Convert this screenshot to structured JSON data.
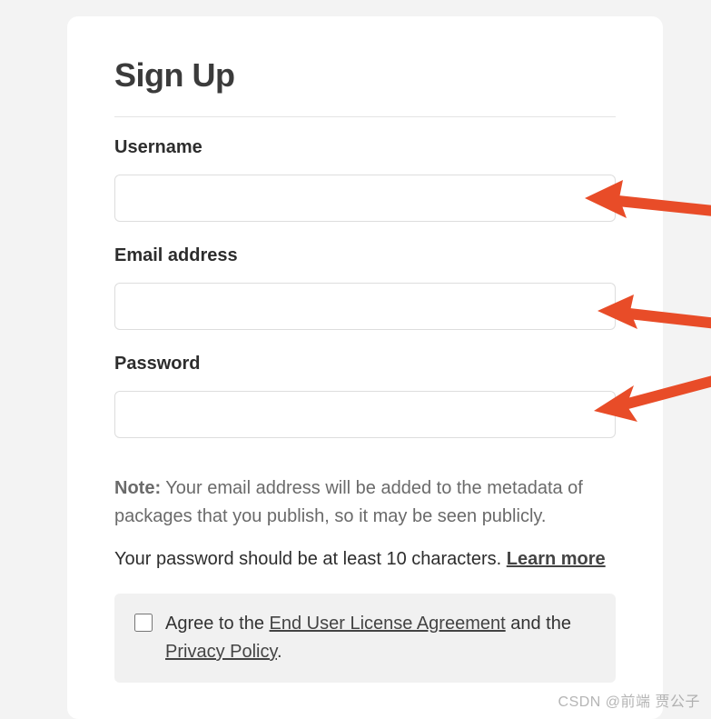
{
  "form": {
    "title": "Sign Up",
    "username_label": "Username",
    "username_value": "",
    "email_label": "Email address",
    "email_value": "",
    "password_label": "Password",
    "password_value": "",
    "note_prefix": "Note:",
    "note_body": " Your email address will be added to the metadata of packages that you publish, so it may be seen publicly.",
    "password_hint": "Your password should be at least 10 characters. ",
    "learn_more": "Learn more",
    "agree_pre": "Agree to the ",
    "eula": "End User License Agreement",
    "agree_mid": " and the ",
    "privacy": "Privacy Policy",
    "agree_end": "."
  },
  "watermark": "CSDN @前端 贾公子",
  "annotations": {
    "arrow_color": "#e84c28"
  }
}
